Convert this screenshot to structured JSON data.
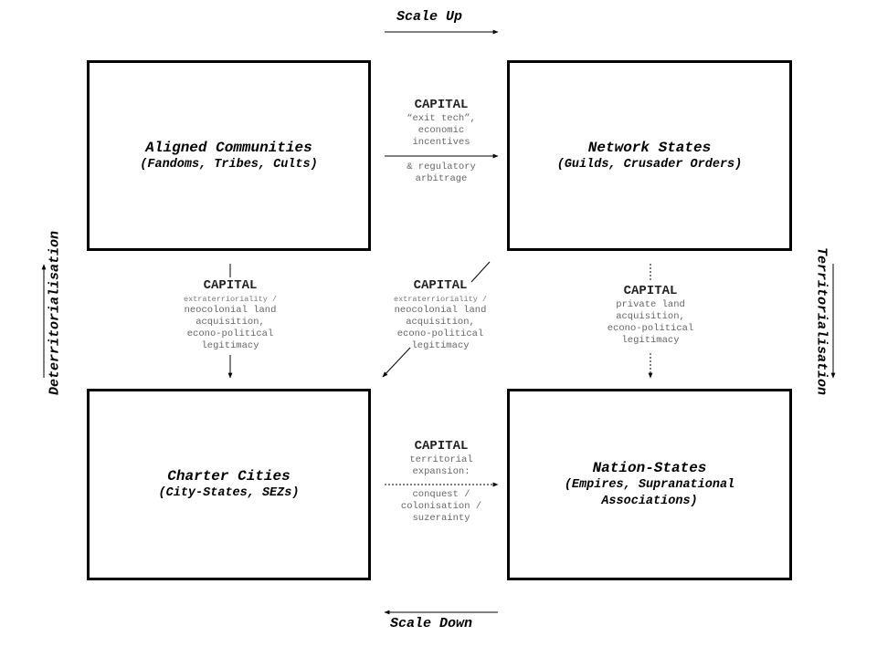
{
  "axes": {
    "top": "Scale Up",
    "bottom": "Scale Down",
    "left": "Deterritorialisation",
    "right": "Territorialisation"
  },
  "nodes": {
    "top_left": {
      "title": "Aligned Communities",
      "subtitle": "(Fandoms, Tribes, Cults)"
    },
    "top_right": {
      "title": "Network States",
      "subtitle": "(Guilds, Crusader Orders)"
    },
    "bottom_left": {
      "title": "Charter Cities",
      "subtitle": "(City-States, SEZs)"
    },
    "bottom_right": {
      "title": "Nation-States",
      "subtitle": "(Empires, Supranational\nAssociations)"
    }
  },
  "edges": {
    "top": {
      "heading": "CAPITAL",
      "above": "“exit tech”,\neconomic\nincentives",
      "below": "& regulatory\narbitrage",
      "style": "solid"
    },
    "left": {
      "heading": "CAPITAL",
      "line1": "extraterrioriality /",
      "rest": "neocolonial land\nacquisition,\necono-political\nlegitimacy",
      "style": "solid"
    },
    "diagonal": {
      "heading": "CAPITAL",
      "line1": "extraterrioriality /",
      "rest": "neocolonial land\nacquisition,\necono-political\nlegitimacy",
      "style": "solid"
    },
    "right": {
      "heading": "CAPITAL",
      "rest": "private land\nacquisition,\necono-political\nlegitimacy",
      "style": "dotted"
    },
    "bottom": {
      "heading": "CAPITAL",
      "above": "territorial\nexpansion:",
      "below": "conquest /\ncolonisation /\nsuzerainty",
      "style": "dotted"
    }
  }
}
